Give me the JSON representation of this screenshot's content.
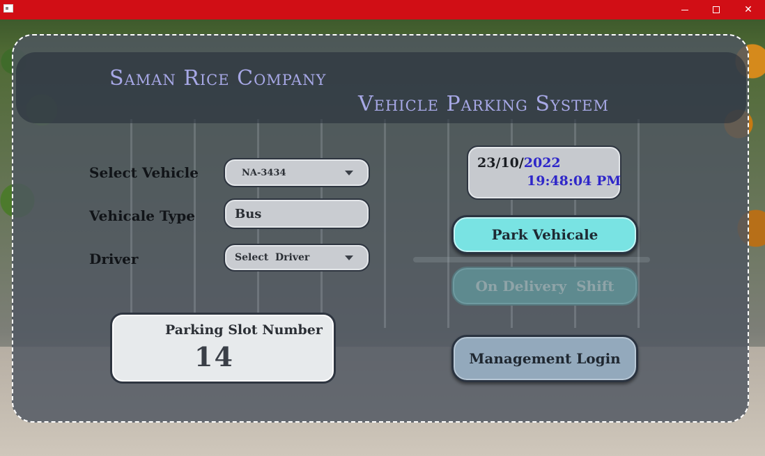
{
  "window": {
    "controls": {
      "minimize_icon": "minimize-icon",
      "maximize_icon": "maximize-icon",
      "close_icon": "close-icon",
      "close_glyph": "✕"
    }
  },
  "header": {
    "company": "Saman Rice Company",
    "system": "Vehicle Parking System"
  },
  "form": {
    "select_vehicle_label": "Select Vehicle",
    "select_vehicle_value": "NA-3434",
    "vehicle_type_label": "Vehicale Type",
    "vehicle_type_value": "Bus",
    "driver_label": "Driver",
    "driver_value": "Select  Driver"
  },
  "clock": {
    "date_prefix": "23/10/",
    "date_year": "2022",
    "time": "19:48:04 PM"
  },
  "buttons": {
    "park": "Park Vehicale",
    "delivery": "On Delivery  Shift",
    "login": "Management Login"
  },
  "slot": {
    "label": "Parking Slot Number",
    "number": "14"
  },
  "colors": {
    "titlebar": "#d10e15",
    "title_text": "#a7a8e6",
    "accent_time": "#2f27c9",
    "park_button": "#79e3e3",
    "login_button": "#93a9bc"
  }
}
